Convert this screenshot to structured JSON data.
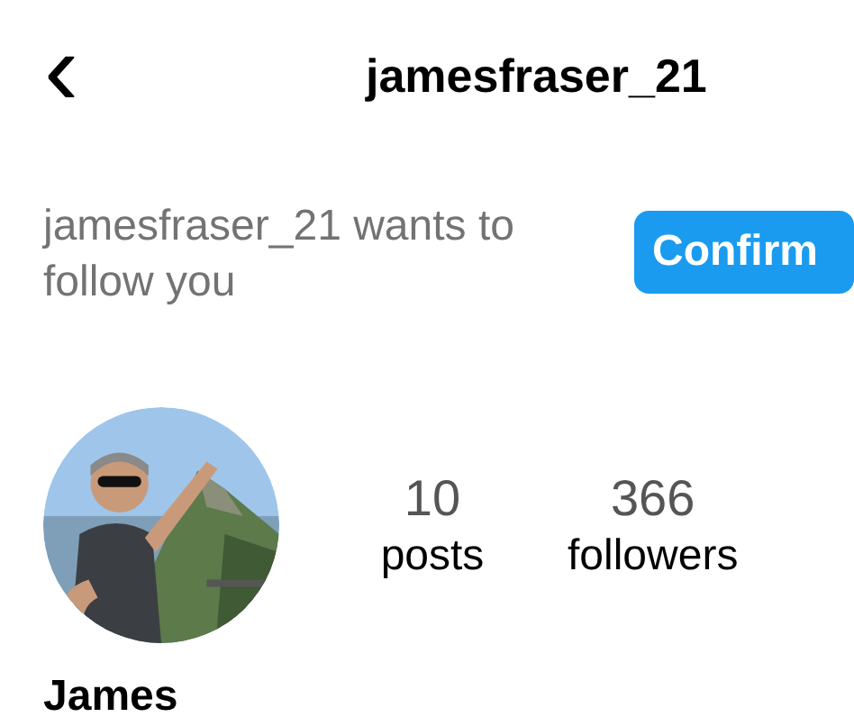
{
  "header": {
    "back_icon": "‹",
    "title": "jamesfraser_21"
  },
  "request": {
    "text": "jamesfraser_21 wants to follow you",
    "button": "Confirm"
  },
  "profile": {
    "name": "James",
    "stats": [
      {
        "value": "10",
        "label": "posts"
      },
      {
        "value": "366",
        "label": "followers"
      }
    ]
  }
}
